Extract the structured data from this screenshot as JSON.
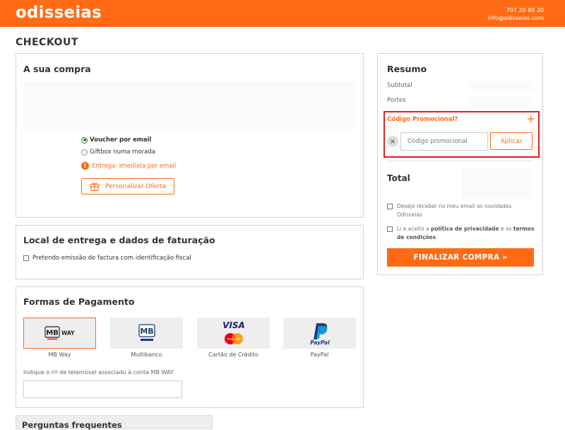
{
  "header": {
    "logo": "odisseias",
    "phone": "707 20 80 20",
    "email": "info@odisseias.com"
  },
  "page_title": "CHECKOUT",
  "purchase": {
    "title": "A sua compra",
    "options": [
      {
        "label": "Voucher por email",
        "selected": true
      },
      {
        "label": "Giftbox numa morada",
        "selected": false
      }
    ],
    "delivery_note": "Entrega: Imediata por email",
    "personalize_label": "Personalizar Oferta"
  },
  "delivery": {
    "title": "Local de entrega e dados de faturação",
    "invoice_checkbox": "Pretendo emissão de factura com identificação fiscal"
  },
  "payment": {
    "title": "Formas de Pagamento",
    "methods": [
      {
        "label": "MB Way",
        "selected": true,
        "icon": "mbway-logo"
      },
      {
        "label": "Multibanco",
        "selected": false,
        "icon": "multibanco-logo"
      },
      {
        "label": "Cartão de Crédito",
        "selected": false,
        "icon": "visa-mastercard-logo"
      },
      {
        "label": "PayPal",
        "selected": false,
        "icon": "paypal-logo"
      }
    ],
    "mbway_hint": "Indique o nº de telemóvel associado à conta MB WAY",
    "mbway_logo_mb": "MB",
    "mbway_logo_way": "WAY",
    "visa_text": "VISA",
    "mastercard_text": "MasterCard",
    "paypal_text": "PayPal"
  },
  "faq": {
    "title": "Perguntas frequentes"
  },
  "summary": {
    "title": "Resumo",
    "subtotal_label": "Subtotal",
    "shipping_label": "Portes",
    "promo_title": "Código Promocional?",
    "promo_plus": "+",
    "promo_clear": "×",
    "promo_placeholder": "Código promocional",
    "promo_apply": "Aplicar",
    "total_label": "Total",
    "newsletter_text": "Desejo receber no meu email as novidades Odisseias",
    "terms_prefix": "Li e aceito a",
    "terms_privacy": "política de privacidade",
    "terms_middle": "e os",
    "terms_conditions": "termos de condições",
    "terms_suffix": ".",
    "finalize_label": "FINALIZAR COMPRA »"
  },
  "colors": {
    "brand": "#ff6a13",
    "highlight": "#e0201c"
  }
}
